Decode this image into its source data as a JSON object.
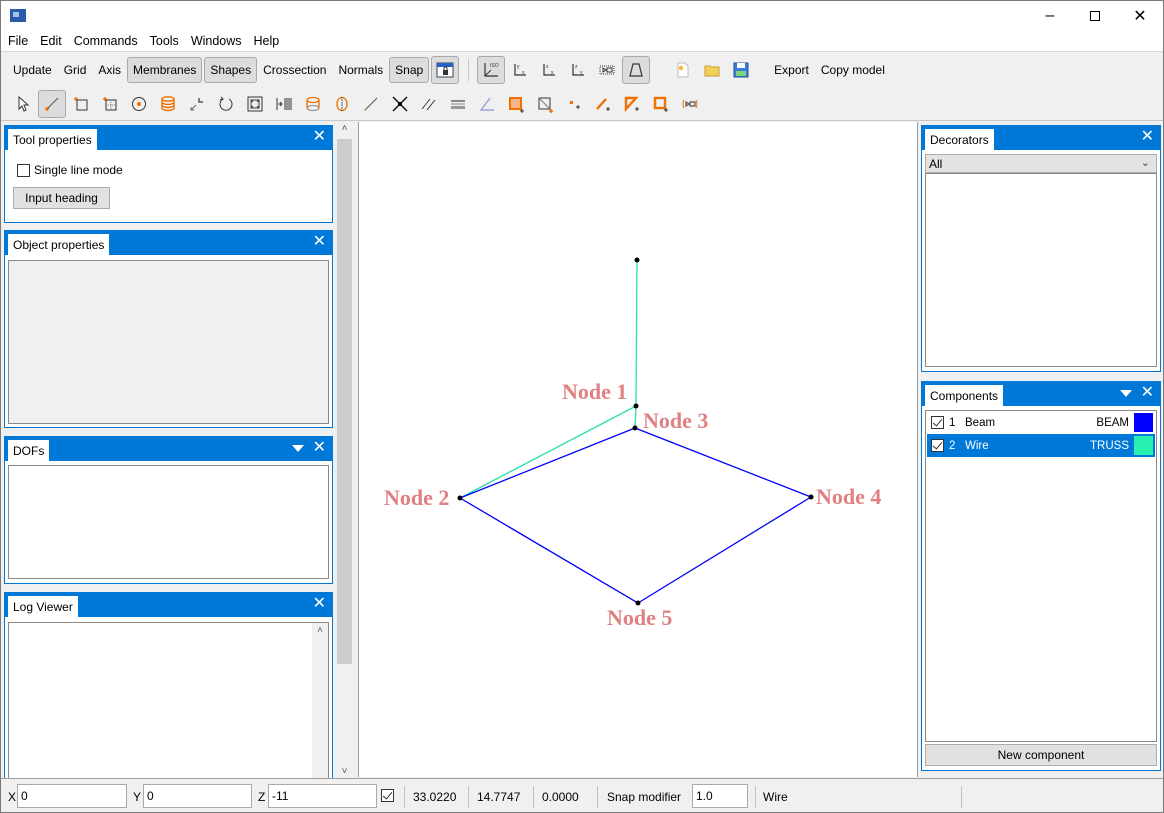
{
  "window": {
    "title": "",
    "controls": {
      "minimize": "–",
      "maximize": "☐",
      "close": "✕"
    }
  },
  "menu": [
    "File",
    "Edit",
    "Commands",
    "Tools",
    "Windows",
    "Help"
  ],
  "toolbar1": {
    "buttons": [
      {
        "label": "Update",
        "active": false
      },
      {
        "label": "Grid",
        "active": false
      },
      {
        "label": "Axis",
        "active": false
      },
      {
        "label": "Membranes",
        "active": true
      },
      {
        "label": "Shapes",
        "active": true
      },
      {
        "label": "Crossection",
        "active": false
      },
      {
        "label": "Normals",
        "active": false
      },
      {
        "label": "Snap",
        "active": true
      }
    ],
    "lock_view_icon": "lock-screen-icon",
    "view_icons": [
      "iso-view-icon",
      "xy-view-icon",
      "xz-view-icon",
      "yz-view-icon",
      "zoom-extents-icon",
      "perspective-icon"
    ],
    "file_icons": [
      "new-file-icon",
      "open-folder-icon",
      "save-icon"
    ],
    "export_label": "Export",
    "copy_model_label": "Copy model"
  },
  "toolbar2": {
    "icons": [
      "select-icon",
      "create-line-icon",
      "create-rect-icon",
      "create-grid-rect-icon",
      "create-circle-icon",
      "create-cylinder-icon",
      "move-icon",
      "rotate-icon",
      "scale-icon",
      "array-icon",
      "create-surface-icon",
      "split-icon",
      "line-icon",
      "intersect-icon",
      "parallel-icon",
      "truss-icon",
      "angle-icon",
      "add-membrane-icon",
      "add-diagonal-icon",
      "add-node-icon",
      "add-element-icon",
      "add-triangle-icon",
      "add-square-icon",
      "link-icon"
    ]
  },
  "left_panels": {
    "tool_properties": {
      "title": "Tool properties",
      "single_line_mode": "Single line mode",
      "single_line_checked": false,
      "input_heading": "Input heading"
    },
    "object_properties": {
      "title": "Object properties"
    },
    "dofs": {
      "title": "DOFs"
    },
    "log_viewer": {
      "title": "Log Viewer"
    }
  },
  "viewport": {
    "nodes": [
      {
        "label": "",
        "id": "top"
      },
      {
        "label": "Node 1"
      },
      {
        "label": "Node 2"
      },
      {
        "label": "Node 3"
      },
      {
        "label": "Node 4"
      },
      {
        "label": "Node 5"
      }
    ],
    "colors": {
      "beam": "#0000ff",
      "wire": "#27e0a8",
      "label": "#e07c7c"
    }
  },
  "right_panels": {
    "decorators": {
      "title": "Decorators",
      "filter": "All"
    },
    "components": {
      "title": "Components",
      "items": [
        {
          "checked": true,
          "index": "1",
          "name": "Beam",
          "type": "BEAM",
          "color": "#0000ff",
          "selected": false
        },
        {
          "checked": true,
          "index": "2",
          "name": "Wire",
          "type": "TRUSS",
          "color": "#27f0b0",
          "selected": true
        }
      ],
      "new_component": "New component"
    }
  },
  "statusbar": {
    "x_label": "X",
    "x_value": "0",
    "y_label": "Y",
    "y_value": "0",
    "z_label": "Z",
    "z_value": "-11",
    "lock_checked": true,
    "coord1": "33.0220",
    "coord2": "14.7747",
    "coord3": "0.0000",
    "snap_modifier_label": "Snap modifier",
    "snap_modifier_value": "1.0",
    "active_component": "Wire"
  }
}
